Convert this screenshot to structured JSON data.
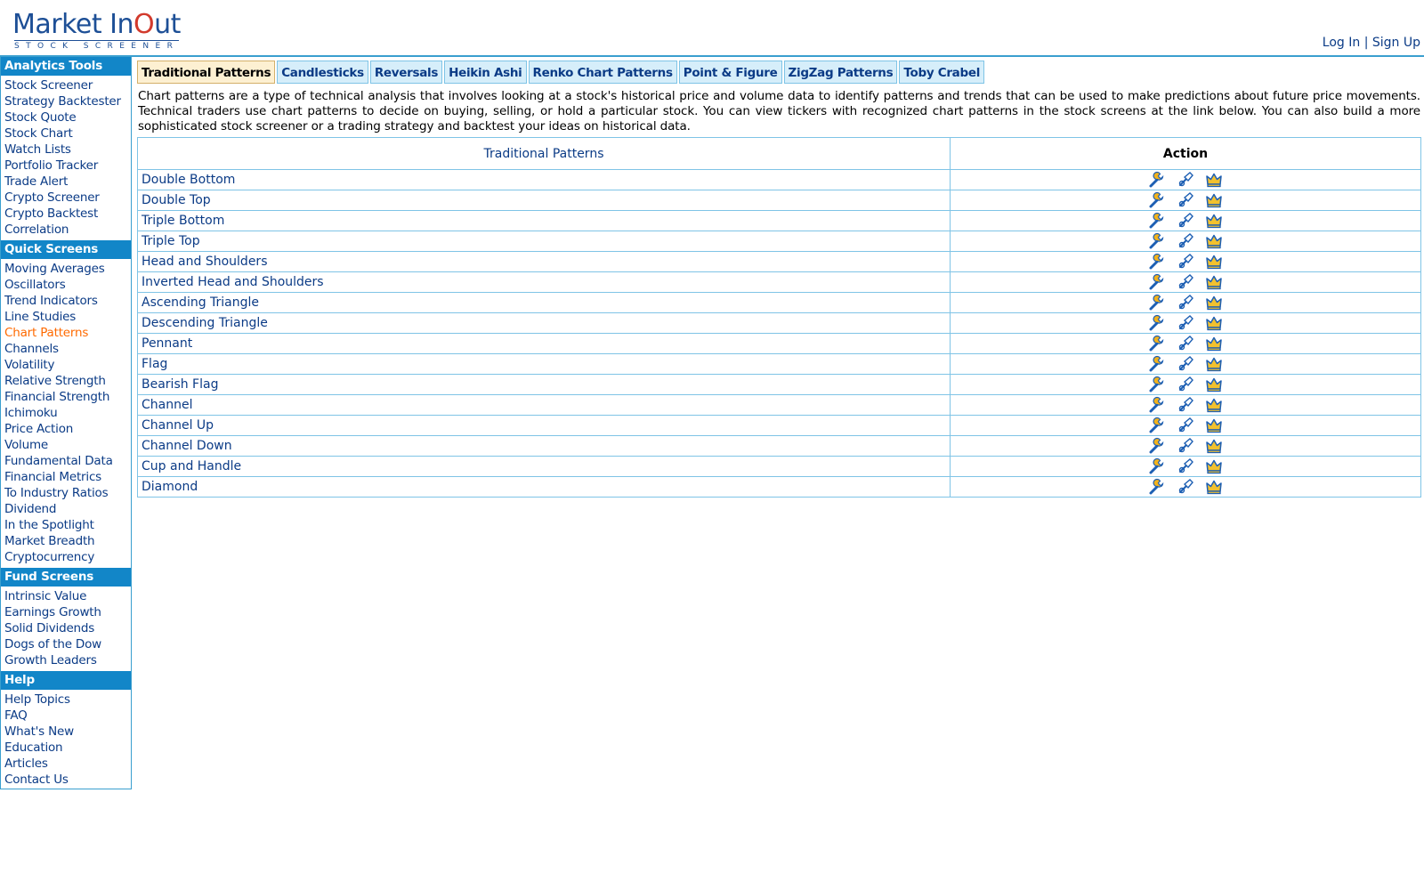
{
  "logo": {
    "brand_part1": "Market In",
    "brand_o": "O",
    "brand_part2": "ut",
    "tagline": "STOCK SCREENER"
  },
  "header": {
    "login": "Log In",
    "separator": "|",
    "signup": "Sign Up"
  },
  "sidebar": {
    "sections": [
      {
        "title": "Analytics Tools",
        "items": [
          "Stock Screener",
          "Strategy Backtester",
          "Stock Quote",
          "Stock Chart",
          "Watch Lists",
          "Portfolio Tracker",
          "Trade Alert",
          "Crypto Screener",
          "Crypto Backtest",
          "Correlation"
        ]
      },
      {
        "title": "Quick Screens",
        "items": [
          "Moving Averages",
          "Oscillators",
          "Trend Indicators",
          "Line Studies",
          "Chart Patterns",
          "Channels",
          "Volatility",
          "Relative Strength",
          "Financial Strength",
          "Ichimoku",
          "Price Action",
          "Volume",
          "Fundamental Data",
          "Financial Metrics",
          "To Industry Ratios",
          "Dividend",
          "In the Spotlight",
          "Market Breadth",
          "Cryptocurrency"
        ]
      },
      {
        "title": "Fund Screens",
        "items": [
          "Intrinsic Value",
          "Earnings Growth",
          "Solid Dividends",
          "Dogs of the Dow",
          "Growth Leaders"
        ]
      },
      {
        "title": "Help",
        "items": [
          "Help Topics",
          "FAQ",
          "What's New",
          "Education",
          "Articles",
          "Contact Us"
        ]
      }
    ],
    "active_item": "Chart Patterns"
  },
  "tabs": [
    "Traditional Patterns",
    "Candlesticks",
    "Reversals",
    "Heikin Ashi",
    "Renko Chart Patterns",
    "Point & Figure",
    "ZigZag Patterns",
    "Toby Crabel"
  ],
  "active_tab": "Traditional Patterns",
  "description": "Chart patterns are a type of technical analysis that involves looking at a stock's historical price and volume data to identify patterns and trends that can be used to make predictions about future price movements. Technical traders use chart patterns to decide on buying, selling, or hold a particular stock. You can view tickers with recognized chart patterns in the stock screens at the link below. You can also build a more sophisticated stock screener or a trading strategy and backtest your ideas on historical data.",
  "table": {
    "col_pattern": "Traditional Patterns",
    "col_action": "Action",
    "rows": [
      "Double Bottom",
      "Double Top",
      "Triple Bottom",
      "Triple Top",
      "Head and Shoulders",
      "Inverted Head and Shoulders",
      "Ascending Triangle",
      "Descending Triangle",
      "Pennant",
      "Flag",
      "Bearish Flag",
      "Channel",
      "Channel Up",
      "Channel Down",
      "Cup and Handle",
      "Diamond"
    ],
    "action_icons": [
      "wrench-icon",
      "pointer-icon",
      "crown-icon"
    ]
  },
  "colors": {
    "accent": "#1286c8",
    "link": "#0b3b86",
    "active": "#ff6a00",
    "border": "#7fc4e6",
    "tab_bg": "#d6eefa",
    "tab_active_bg": "#fdf0d2"
  }
}
